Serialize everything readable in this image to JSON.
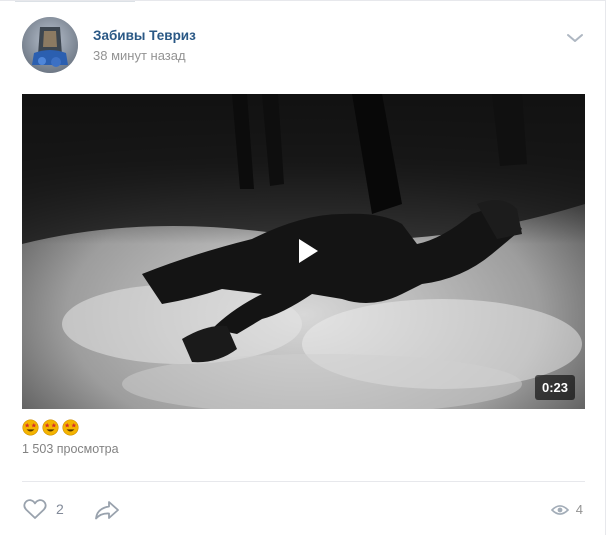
{
  "post": {
    "author": "Забивы Тевриз",
    "time": "38 минут назад",
    "video_duration": "0:23",
    "reactions": [
      "star-struck-emoji",
      "star-struck-emoji",
      "star-struck-emoji"
    ],
    "views_text": "1 503 просмотра",
    "likes": "2",
    "views_count": "4"
  },
  "icons": {
    "menu": "chevron-down-icon",
    "play": "play-icon",
    "like": "heart-icon",
    "share": "share-arrow-icon",
    "views": "eye-icon"
  },
  "colors": {
    "author": "#2a5885",
    "muted": "#939393",
    "icon": "#99a2ad"
  }
}
